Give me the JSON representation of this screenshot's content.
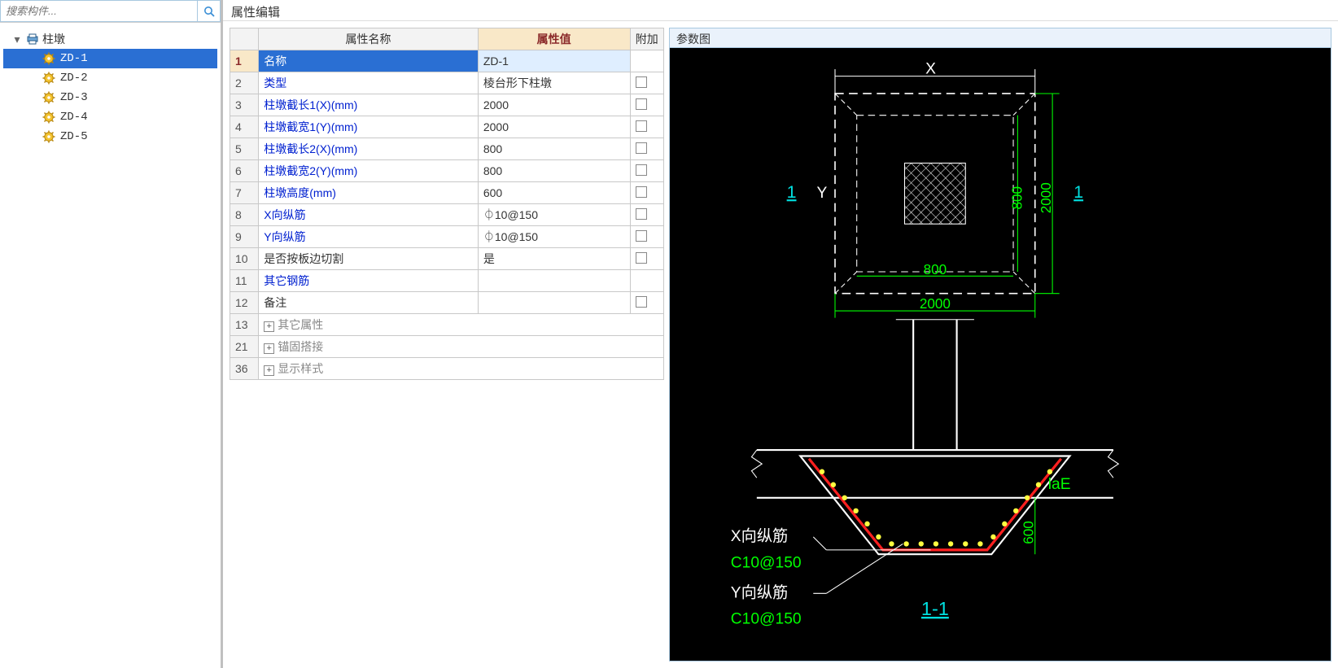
{
  "search": {
    "placeholder": "搜索构件..."
  },
  "tree": {
    "root_label": "柱墩",
    "items": [
      {
        "label": "ZD-1",
        "selected": true
      },
      {
        "label": "ZD-2",
        "selected": false
      },
      {
        "label": "ZD-3",
        "selected": false
      },
      {
        "label": "ZD-4",
        "selected": false
      },
      {
        "label": "ZD-5",
        "selected": false
      }
    ]
  },
  "panel_title": "属性编辑",
  "table": {
    "headers": {
      "name": "属性名称",
      "value": "属性值",
      "extra": "附加"
    },
    "rows": [
      {
        "idx": "1",
        "name": "名称",
        "value": "ZD-1",
        "style": "selected",
        "checkbox": false
      },
      {
        "idx": "2",
        "name": "类型",
        "value": "棱台形下柱墩",
        "style": "link",
        "checkbox": true
      },
      {
        "idx": "3",
        "name": "柱墩截长1(X)(mm)",
        "value": "2000",
        "style": "link",
        "checkbox": true
      },
      {
        "idx": "4",
        "name": "柱墩截宽1(Y)(mm)",
        "value": "2000",
        "style": "link",
        "checkbox": true
      },
      {
        "idx": "5",
        "name": "柱墩截长2(X)(mm)",
        "value": "800",
        "style": "link",
        "checkbox": true
      },
      {
        "idx": "6",
        "name": "柱墩截宽2(Y)(mm)",
        "value": "800",
        "style": "link",
        "checkbox": true
      },
      {
        "idx": "7",
        "name": "柱墩高度(mm)",
        "value": "600",
        "style": "link",
        "checkbox": true
      },
      {
        "idx": "8",
        "name": "X向纵筋",
        "value": "⏀10@150",
        "style": "link",
        "checkbox": true
      },
      {
        "idx": "9",
        "name": "Y向纵筋",
        "value": "⏀10@150",
        "style": "link",
        "checkbox": true
      },
      {
        "idx": "10",
        "name": "是否按板边切割",
        "value": "是",
        "style": "plain",
        "checkbox": true
      },
      {
        "idx": "11",
        "name": "其它钢筋",
        "value": "",
        "style": "link",
        "checkbox": false
      },
      {
        "idx": "12",
        "name": "备注",
        "value": "",
        "style": "plain",
        "checkbox": true
      },
      {
        "idx": "13",
        "name": "其它属性",
        "value": "",
        "style": "group",
        "checkbox": false
      },
      {
        "idx": "21",
        "name": "锚固搭接",
        "value": "",
        "style": "group",
        "checkbox": false
      },
      {
        "idx": "36",
        "name": "显示样式",
        "value": "",
        "style": "group",
        "checkbox": false
      }
    ]
  },
  "diagram": {
    "title": "参数图",
    "labels": {
      "X": "X",
      "Y": "Y",
      "one_left": "1",
      "one_right": "1",
      "dim_2000_b": "2000",
      "dim_2000_r": "2000",
      "dim_800_b": "800",
      "dim_800_r": "800",
      "dim_600": "600",
      "laE": "laE",
      "x_rebar_label": "X向纵筋",
      "x_rebar_spec": "C10@150",
      "y_rebar_label": "Y向纵筋",
      "y_rebar_spec": "C10@150",
      "section_label": "1-1"
    }
  }
}
